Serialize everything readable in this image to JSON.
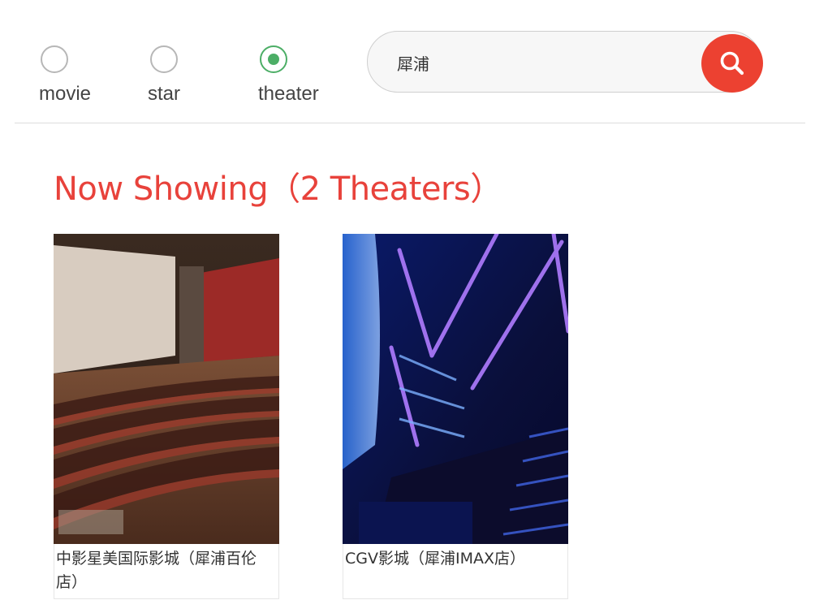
{
  "search_type": {
    "options": [
      {
        "label": "movie",
        "checked": false
      },
      {
        "label": "star",
        "checked": false
      },
      {
        "label": "theater",
        "checked": true
      }
    ]
  },
  "search": {
    "value": "犀浦",
    "button_icon": "search-icon"
  },
  "colors": {
    "accent": "#e8423b",
    "radio_checked": "#4cae66",
    "search_button": "#ec4131"
  },
  "section": {
    "title": "Now Showing（2 Theaters）"
  },
  "theaters": [
    {
      "name": "中影星美国际影城（犀浦百伦店）",
      "image": "cinema-auditorium-photo-red-seats"
    },
    {
      "name": "CGV影城（犀浦IMAX店）",
      "image": "cinema-auditorium-photo-blue-lights"
    }
  ]
}
